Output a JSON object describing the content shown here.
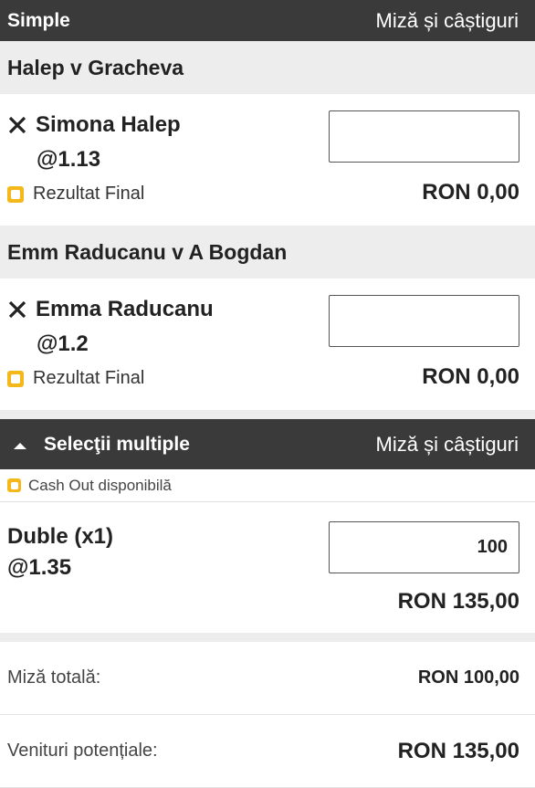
{
  "single": {
    "header_title": "Simple",
    "header_right": "Miză și câștiguri",
    "events": [
      {
        "name": "Halep v Gracheva",
        "selection": "Simona Halep",
        "odds": "@1.13",
        "market": "Rezultat Final",
        "stake": "",
        "payout": "RON 0,00"
      },
      {
        "name": "Emm Raducanu v A Bogdan",
        "selection": "Emma Raducanu",
        "odds": "@1.2",
        "market": "Rezultat Final",
        "stake": "",
        "payout": "RON 0,00"
      }
    ]
  },
  "multiple": {
    "header_title": "Selecţii multiple",
    "header_right": "Miză și câștiguri",
    "cashout": "Cash Out disponibilă",
    "bet_name": "Duble (x1)",
    "odds": "@1.35",
    "stake": "100",
    "payout": "RON 135,00"
  },
  "summary": {
    "total_stake_label": "Miză totală:",
    "total_stake_value": "RON 100,00",
    "potential_label": "Venituri potențiale:",
    "potential_value": "RON 135,00"
  },
  "colors": {
    "header_bg": "#3a3a3a",
    "section_bg": "#ededed",
    "cashout_icon": "#f5b81a"
  },
  "icons": {
    "remove": "close-icon",
    "market": "cashout-icon",
    "collapse": "caret-up-icon"
  }
}
